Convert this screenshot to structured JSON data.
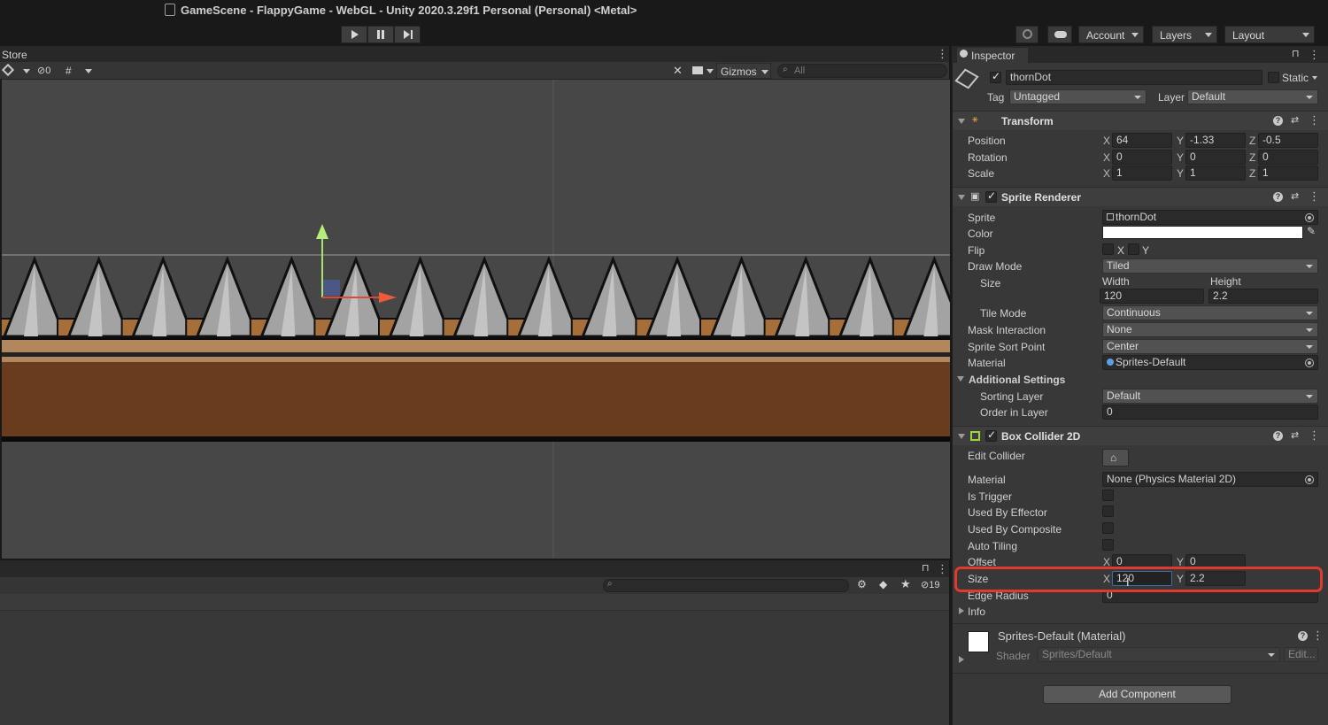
{
  "window": {
    "title": "GameScene - FlappyGame - WebGL - Unity 2020.3.29f1 Personal (Personal) <Metal>"
  },
  "toolbar": {
    "account": "Account",
    "layers": "Layers",
    "layout": "Layout"
  },
  "scene": {
    "tab_label": "Store",
    "hidden_count": "0",
    "gizmos_label": "Gizmos",
    "search_placeholder": "All"
  },
  "project": {
    "hidden_count": "19"
  },
  "inspector": {
    "tab_label": "Inspector",
    "object_name": "thornDot",
    "static_label": "Static",
    "tag_label": "Tag",
    "tag_value": "Untagged",
    "layer_label": "Layer",
    "layer_value": "Default",
    "transform": {
      "title": "Transform",
      "position_label": "Position",
      "rotation_label": "Rotation",
      "scale_label": "Scale",
      "position": {
        "x": "64",
        "y": "-1.33",
        "z": "-0.5"
      },
      "rotation": {
        "x": "0",
        "y": "0",
        "z": "0"
      },
      "scale": {
        "x": "1",
        "y": "1",
        "z": "1"
      }
    },
    "sprite_renderer": {
      "title": "Sprite Renderer",
      "sprite_label": "Sprite",
      "sprite_value": "thornDot",
      "color_label": "Color",
      "color_value": "#ffffff",
      "flip_label": "Flip",
      "flip_x": "X",
      "flip_y": "Y",
      "draw_mode_label": "Draw Mode",
      "draw_mode_value": "Tiled",
      "size_label": "Size",
      "width_label": "Width",
      "height_label": "Height",
      "width_value": "120",
      "height_value": "2.2",
      "tile_mode_label": "Tile Mode",
      "tile_mode_value": "Continuous",
      "mask_label": "Mask Interaction",
      "mask_value": "None",
      "sort_point_label": "Sprite Sort Point",
      "sort_point_value": "Center",
      "material_label": "Material",
      "material_value": "Sprites-Default",
      "additional_label": "Additional Settings",
      "sorting_layer_label": "Sorting Layer",
      "sorting_layer_value": "Default",
      "order_label": "Order in Layer",
      "order_value": "0"
    },
    "box_collider": {
      "title": "Box Collider 2D",
      "edit_label": "Edit Collider",
      "material_label": "Material",
      "material_value": "None (Physics Material 2D)",
      "trigger_label": "Is Trigger",
      "effector_label": "Used By Effector",
      "composite_label": "Used By Composite",
      "tiling_label": "Auto Tiling",
      "offset_label": "Offset",
      "offset_x": "0",
      "offset_y": "0",
      "size_label": "Size",
      "size_x": "120",
      "size_y": "2.2",
      "edge_label": "Edge Radius",
      "edge_value": "0",
      "info_label": "Info"
    },
    "material": {
      "title": "Sprites-Default (Material)",
      "shader_label": "Shader",
      "shader_value": "Sprites/Default",
      "edit_label": "Edit..."
    },
    "add_component": "Add Component"
  },
  "colors": {
    "highlight": "#e03a2f",
    "accent_field": "#3d6ea8"
  }
}
